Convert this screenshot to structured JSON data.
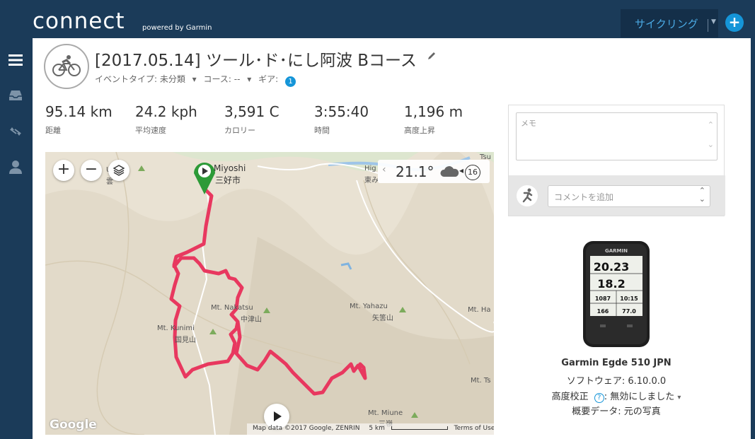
{
  "header": {
    "logo": "connect",
    "logo_sub": "powered by Garmin",
    "activity_type": "サイクリング",
    "add_label": "+"
  },
  "activity": {
    "title": "[2017.05.14] ツール･ド･にし阿波 Bコース",
    "event_type": "イベントタイプ: 未分類",
    "course": "コース: --",
    "gear": "ギア:",
    "gear_count": "1"
  },
  "stats": [
    {
      "value": "95.14 km",
      "label": "距離"
    },
    {
      "value": "24.2 kph",
      "label": "平均速度"
    },
    {
      "value": "3,591 C",
      "label": "カロリー"
    },
    {
      "value": "3:55:40",
      "label": "時間"
    },
    {
      "value": "1,196 m",
      "label": "高度上昇"
    }
  ],
  "map": {
    "zoom_in": "+",
    "zoom_out": "−",
    "temperature": "21.1°",
    "wind_speed": "16",
    "google": "Google",
    "attribution": "Map data ©2017 Google, ZENRIN",
    "scale": "5 km",
    "terms": "Terms of Use",
    "labels": {
      "miyoshi": "Miyoshi",
      "miyoshi_jp": "三好市",
      "nakatsu": "Mt. Nakatsu",
      "nakatsu_jp": "中津山",
      "kunimi": "Mt. Kunimi",
      "kunimi_jp": "国見山",
      "yahazu": "Mt. Yahazu",
      "yahazu_jp": "矢筈山",
      "miune": "Mt. Miune",
      "miune_jp": "三嶺",
      "tsu": "Tsu",
      "hig": "Hig",
      "higashi": "東み",
      "mt_ha": "Mt. Ha",
      "mt_ts": "Mt. Ts",
      "u": "U",
      "u_jp": "雲"
    }
  },
  "notes": {
    "memo_placeholder": "メモ",
    "comment_placeholder": "コメントを追加"
  },
  "device": {
    "brand": "GARMIN",
    "screen_values": [
      "20.23",
      "18.2",
      "1087",
      "10:15",
      "166",
      "77.0"
    ],
    "name": "Garmin Egde 510 JPN",
    "software": "ソフトウェア: 6.10.0.0",
    "altitude_label": "高度校正",
    "altitude_value": ": 無効にしました",
    "summary": "概要データ: 元の写真"
  }
}
